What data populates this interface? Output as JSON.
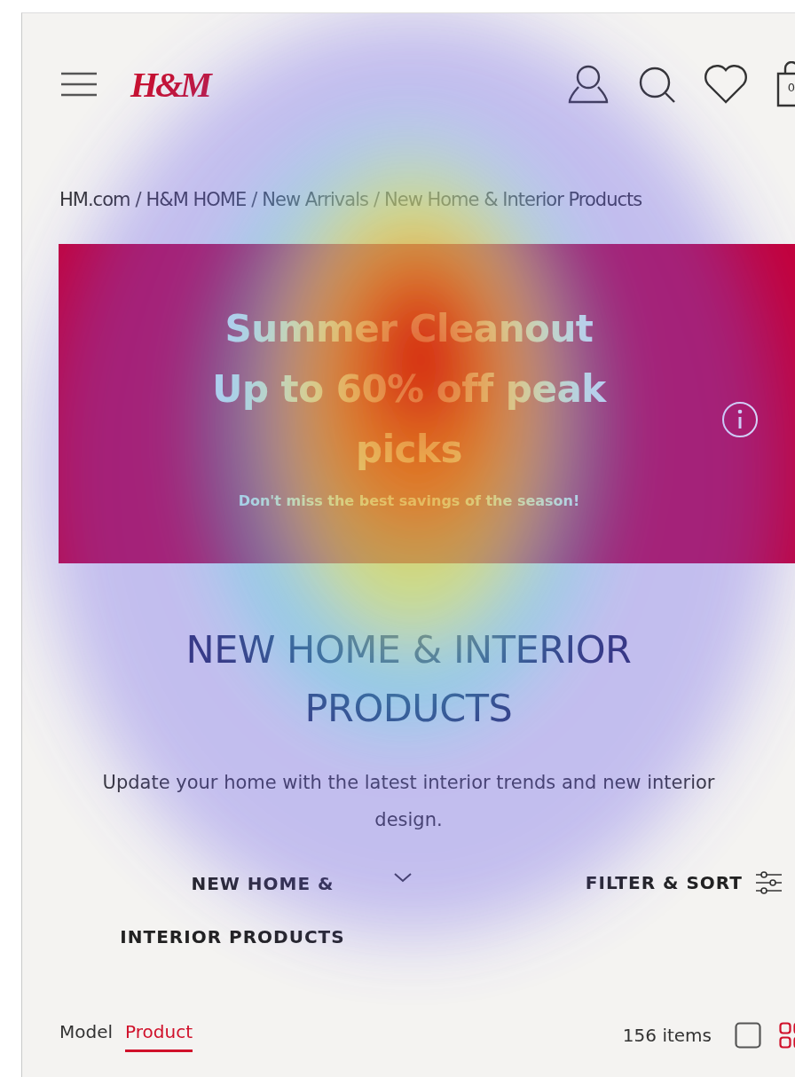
{
  "header": {
    "logo": "H&M",
    "bag_count": "0"
  },
  "breadcrumb": [
    {
      "label": "HM.com",
      "separator": "/"
    },
    {
      "label": "H&M HOME",
      "separator": "/"
    },
    {
      "label": "New Arrivals",
      "separator": "/"
    },
    {
      "label": "New Home & Interior Products"
    }
  ],
  "banner": {
    "title_lines": [
      "Summer Cleanout",
      "Up to 60% off peak",
      "picks"
    ],
    "subtitle": "Don't miss the best savings of the season!"
  },
  "heading": [
    "NEW HOME & INTERIOR",
    "PRODUCTS"
  ],
  "description": "Update your home with the latest interior trends and new interior design.",
  "category_dropdown": {
    "label_lines": [
      "NEW HOME &",
      "INTERIOR PRODUCTS"
    ]
  },
  "filter_button": {
    "label": "FILTER & SORT"
  },
  "image_tabs": [
    {
      "label": "Model",
      "selected": false
    },
    {
      "label": "Product",
      "selected": true
    }
  ],
  "item_count": "156 items",
  "view_options": [
    {
      "kind": "single",
      "selected": false
    },
    {
      "kind": "grid",
      "selected": true
    }
  ]
}
